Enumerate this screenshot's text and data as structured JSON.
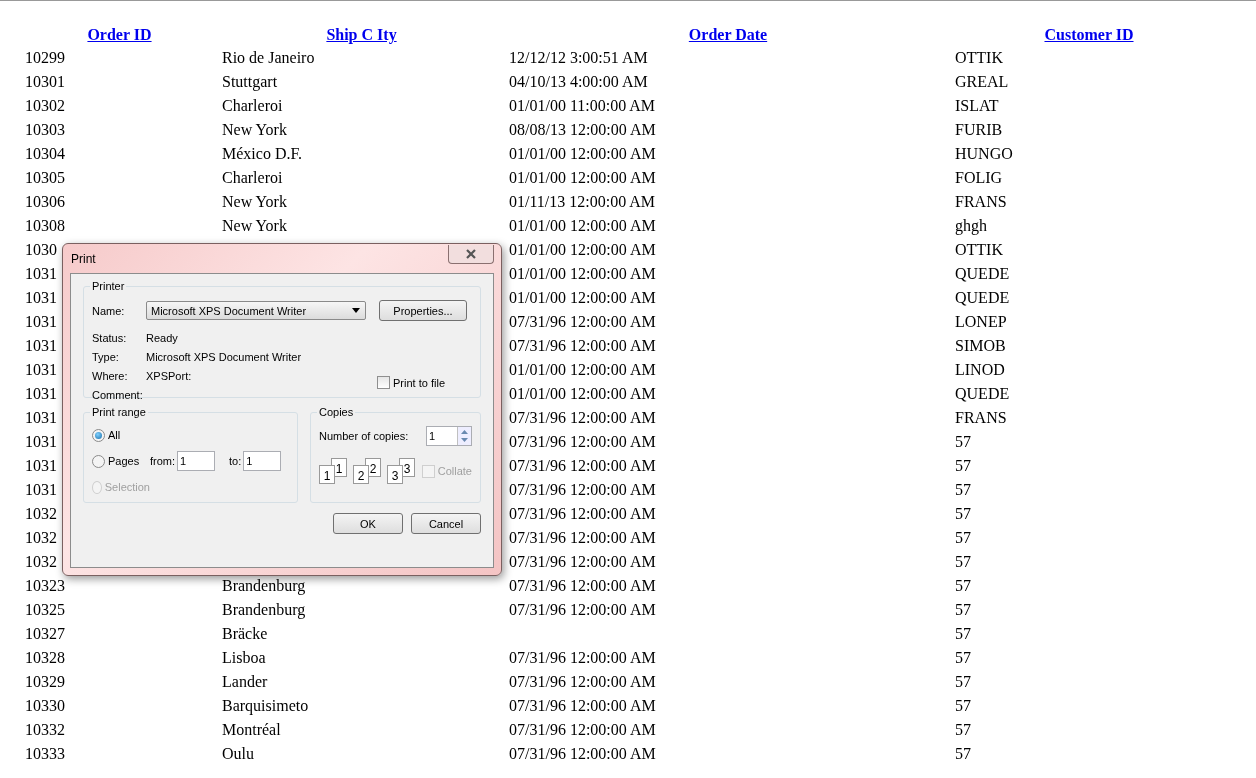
{
  "table": {
    "columns": [
      "Order ID",
      "Ship C Ity",
      "Order Date",
      "Customer ID"
    ],
    "rows": [
      {
        "order_id": "10299",
        "ship_city": "Rio de Janeiro",
        "order_date": "12/12/12 3:00:51 AM",
        "customer_id": "OTTIK"
      },
      {
        "order_id": "10301",
        "ship_city": "Stuttgart",
        "order_date": "04/10/13 4:00:00 AM",
        "customer_id": "GREAL"
      },
      {
        "order_id": "10302",
        "ship_city": "Charleroi",
        "order_date": "01/01/00 11:00:00 AM",
        "customer_id": "ISLAT"
      },
      {
        "order_id": "10303",
        "ship_city": "New York",
        "order_date": "08/08/13 12:00:00 AM",
        "customer_id": "FURIB"
      },
      {
        "order_id": "10304",
        "ship_city": "México D.F.",
        "order_date": "01/01/00 12:00:00 AM",
        "customer_id": "HUNGO"
      },
      {
        "order_id": "10305",
        "ship_city": "Charleroi",
        "order_date": "01/01/00 12:00:00 AM",
        "customer_id": "FOLIG"
      },
      {
        "order_id": "10306",
        "ship_city": "New York",
        "order_date": "01/11/13 12:00:00 AM",
        "customer_id": "FRANS"
      },
      {
        "order_id": "10308",
        "ship_city": "New York",
        "order_date": "01/01/00 12:00:00 AM",
        "customer_id": "ghgh"
      },
      {
        "order_id": "1030",
        "order_date": "01/01/00 12:00:00 AM",
        "customer_id": "OTTIK"
      },
      {
        "order_id": "1031",
        "order_date": "01/01/00 12:00:00 AM",
        "customer_id": "QUEDE"
      },
      {
        "order_id": "1031",
        "order_date": "01/01/00 12:00:00 AM",
        "customer_id": "QUEDE"
      },
      {
        "order_id": "1031",
        "order_date": "07/31/96 12:00:00 AM",
        "customer_id": "LONEP"
      },
      {
        "order_id": "1031",
        "order_date": "07/31/96 12:00:00 AM",
        "customer_id": "SIMOB"
      },
      {
        "order_id": "1031",
        "order_date": "01/01/00 12:00:00 AM",
        "customer_id": "LINOD"
      },
      {
        "order_id": "1031",
        "order_date": "01/01/00 12:00:00 AM",
        "customer_id": "QUEDE"
      },
      {
        "order_id": "1031",
        "order_date": "07/31/96 12:00:00 AM",
        "customer_id": "FRANS"
      },
      {
        "order_id": "1031",
        "order_date": "07/31/96 12:00:00 AM",
        "customer_id": "57"
      },
      {
        "order_id": "1031",
        "order_date": "07/31/96 12:00:00 AM",
        "customer_id": "57"
      },
      {
        "order_id": "1031",
        "order_date": "07/31/96 12:00:00 AM",
        "customer_id": "57"
      },
      {
        "order_id": "1032",
        "order_date": "07/31/96 12:00:00 AM",
        "customer_id": "57"
      },
      {
        "order_id": "1032",
        "order_date": "07/31/96 12:00:00 AM",
        "customer_id": "57"
      },
      {
        "order_id": "1032",
        "order_date": "07/31/96 12:00:00 AM",
        "customer_id": "57"
      },
      {
        "order_id": "10323",
        "ship_city": "Brandenburg",
        "order_date": "07/31/96 12:00:00 AM",
        "customer_id": "57"
      },
      {
        "order_id": "10325",
        "ship_city": "Brandenburg",
        "order_date": "07/31/96 12:00:00 AM",
        "customer_id": "57"
      },
      {
        "order_id": "10327",
        "ship_city": "Bräcke",
        "customer_id": "57"
      },
      {
        "order_id": "10328",
        "ship_city": "Lisboa",
        "order_date": "07/31/96 12:00:00 AM",
        "customer_id": "57"
      },
      {
        "order_id": "10329",
        "ship_city": "Lander",
        "order_date": "07/31/96 12:00:00 AM",
        "customer_id": "57"
      },
      {
        "order_id": "10330",
        "ship_city": "Barquisimeto",
        "order_date": "07/31/96 12:00:00 AM",
        "customer_id": "57"
      },
      {
        "order_id": "10332",
        "ship_city": "Montréal",
        "order_date": "07/31/96 12:00:00 AM",
        "customer_id": "57"
      },
      {
        "order_id": "10333",
        "ship_city": "Oulu",
        "order_date": "07/31/96 12:00:00 AM",
        "customer_id": "57"
      }
    ]
  },
  "print_dialog": {
    "title": "Print",
    "printer": {
      "legend": "Printer",
      "name_label": "Name:",
      "name_value": "Microsoft XPS Document Writer",
      "properties_button": "Properties...",
      "info": [
        {
          "label": "Status:",
          "value": "Ready"
        },
        {
          "label": "Type:",
          "value": "Microsoft XPS Document Writer"
        },
        {
          "label": "Where:",
          "value": "XPSPort:"
        },
        {
          "label": "Comment:"
        }
      ],
      "print_to_file": {
        "label": "Print to file",
        "checked": false
      }
    },
    "print_range": {
      "legend": "Print range",
      "options": [
        {
          "kind": "all",
          "label": "All",
          "selected": true,
          "disabled": false
        },
        {
          "kind": "pages",
          "label": "Pages",
          "selected": false,
          "disabled": false,
          "from_label": "from:",
          "from_value": "1",
          "to_label": "to:",
          "to_value": "1"
        },
        {
          "kind": "selection",
          "label": "Selection",
          "selected": false,
          "disabled": true
        }
      ]
    },
    "copies": {
      "legend": "Copies",
      "count_label": "Number of copies:",
      "count_value": "1",
      "collate_sheets": [
        {
          "back": "1",
          "front": "1"
        },
        {
          "back": "2",
          "front": "2"
        },
        {
          "back": "3",
          "front": "3"
        }
      ],
      "collate": {
        "label": "Collate",
        "checked": false,
        "disabled": true
      }
    },
    "buttons": [
      "OK",
      "Cancel"
    ]
  }
}
